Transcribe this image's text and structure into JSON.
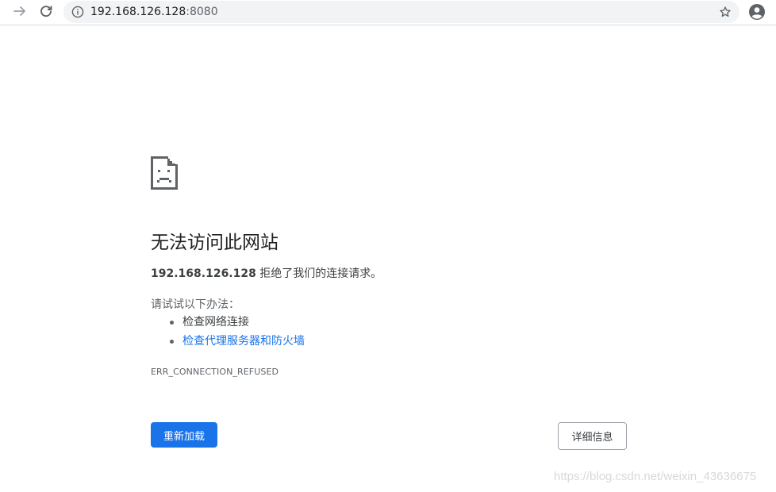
{
  "toolbar": {
    "back_icon": "arrow-forward-icon",
    "reload_icon": "reload-icon",
    "info_icon": "info-icon",
    "star_icon": "star-icon",
    "profile_icon": "profile-icon",
    "url_host": "192.168.126.128",
    "url_port": ":8080"
  },
  "error": {
    "icon": "sad-document-icon",
    "title": "无法访问此网站",
    "host": "192.168.126.128",
    "message": " 拒绝了我们的连接请求。",
    "suggest_heading": "请试试以下办法：",
    "suggestions": [
      {
        "label": "检查网络连接",
        "is_link": false
      },
      {
        "label": "检查代理服务器和防火墙",
        "is_link": true
      }
    ],
    "code": "ERR_CONNECTION_REFUSED",
    "reload_label": "重新加载",
    "details_label": "详细信息"
  },
  "watermark": "https://blog.csdn.net/weixin_43636675",
  "colors": {
    "accent": "#1a73e8",
    "text": "#202124",
    "secondary_text": "#5f6368"
  }
}
